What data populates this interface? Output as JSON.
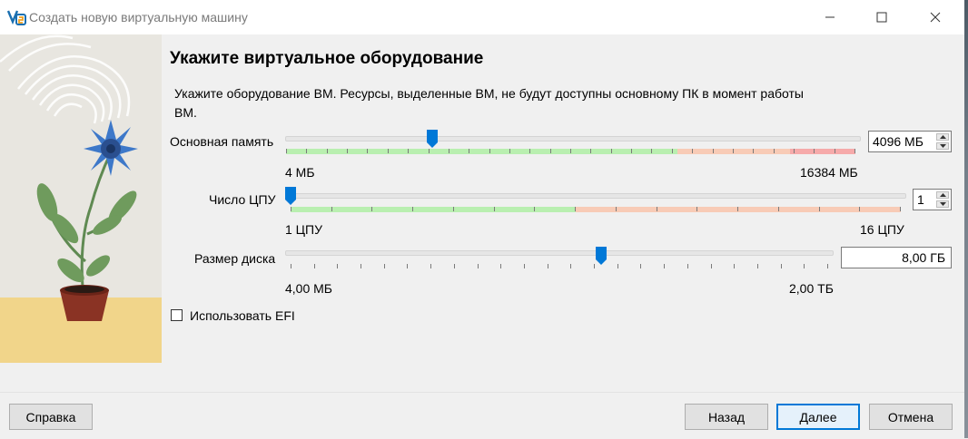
{
  "window": {
    "title": "Создать новую виртуальную машину"
  },
  "heading": "Укажите виртуальное оборудование",
  "description": "Укажите оборудование ВМ. Ресурсы, выделенные ВМ, не будут доступны основному ПК в момент работы ВМ.",
  "memory": {
    "label": "Основная память",
    "value": "4096 МБ",
    "min_label": "4 МБ",
    "max_label": "16384 МБ",
    "fraction": 0.25
  },
  "cpu": {
    "label": "Число ЦПУ",
    "value": "1",
    "min_label": "1 ЦПУ",
    "max_label": "16 ЦПУ",
    "fraction": 0.0
  },
  "disk": {
    "label": "Размер диска",
    "value": "8,00 ГБ",
    "min_label": "4,00 МБ",
    "max_label": "2,00 ТБ",
    "fraction": 0.576
  },
  "efi": {
    "label": "Использовать EFI",
    "checked": false
  },
  "buttons": {
    "help": "Справка",
    "back": "Назад",
    "next": "Далее",
    "cancel": "Отмена"
  },
  "colors": {
    "accent": "#0078d7",
    "safe_range": "#b9efb0",
    "warning_range": "#f8cbb6",
    "danger_range": "#f6aaaa"
  }
}
